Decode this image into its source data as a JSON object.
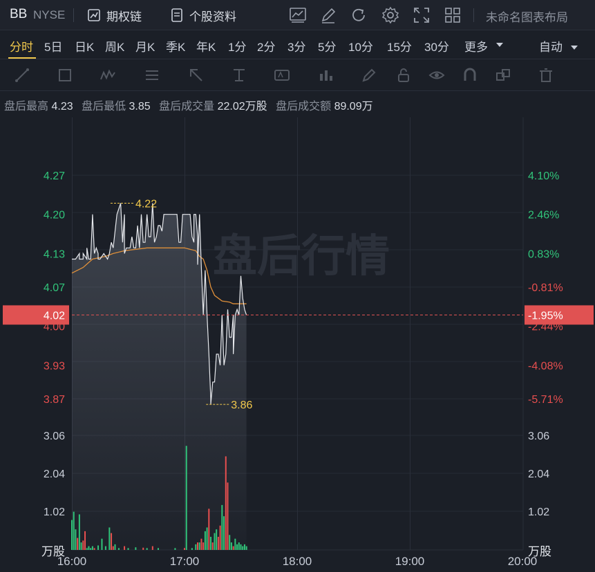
{
  "toolbar": {
    "symbol": "BB",
    "exchange": "NYSE",
    "options_chain": "期权链",
    "stock_info": "个股资料",
    "layout_name": "未命名图表布局",
    "icons": [
      "chart-type-icon",
      "draw-icon",
      "refresh-icon",
      "settings-icon",
      "fullscreen-icon",
      "layout-grid-icon"
    ]
  },
  "periods": {
    "items": [
      "分时",
      "5日",
      "日K",
      "周K",
      "月K",
      "季K",
      "年K",
      "1分",
      "2分",
      "3分",
      "5分",
      "10分",
      "15分",
      "30分",
      "更多"
    ],
    "active": "分时",
    "auto_label": "自动"
  },
  "info": {
    "high_label": "盘后最高",
    "high": "4.23",
    "low_label": "盘后最低",
    "low": "3.85",
    "volume_label": "盘后成交量",
    "volume": "22.02万股",
    "amount_label": "盘后成交额",
    "amount": "89.09万"
  },
  "chart_data": {
    "type": "line",
    "watermark": "盘后行情",
    "x_ticks": [
      "16:00",
      "17:00",
      "18:00",
      "19:00",
      "20:00"
    ],
    "price_ticks": [
      "4.27",
      "4.20",
      "4.13",
      "4.07",
      "4.00",
      "3.93",
      "3.87"
    ],
    "pct_ticks": [
      "4.10%",
      "2.46%",
      "0.83%",
      "-0.81%",
      "-2.44%",
      "-4.08%",
      "-5.71%"
    ],
    "volume_ticks": [
      "3.06",
      "2.04",
      "1.02"
    ],
    "volume_unit": "万股",
    "current_price": "4.02",
    "current_pct": "-1.95%",
    "high_marker": "4.22",
    "low_marker": "3.86",
    "colors": {
      "up": "#e84f4f",
      "down": "#31c47a",
      "avg": "#e0903a",
      "price": "#e8eaee",
      "marker": "#f2c94c",
      "current_bg": "#e05252"
    },
    "price_series": [
      [
        0,
        4.12
      ],
      [
        2,
        4.12
      ],
      [
        4,
        4.13
      ],
      [
        4,
        4.12
      ],
      [
        6,
        4.12
      ],
      [
        6,
        4.13
      ],
      [
        8,
        4.12
      ],
      [
        8,
        4.14
      ],
      [
        9,
        4.12
      ],
      [
        10,
        4.12
      ],
      [
        11,
        4.2
      ],
      [
        12,
        4.13
      ],
      [
        13,
        4.14
      ],
      [
        14,
        4.13
      ],
      [
        14,
        4.12
      ],
      [
        15,
        4.12
      ],
      [
        17,
        4.13
      ],
      [
        19,
        4.12
      ],
      [
        20,
        4.13
      ],
      [
        21,
        4.15
      ],
      [
        22,
        4.14
      ],
      [
        24,
        4.2
      ],
      [
        26,
        4.22
      ],
      [
        27,
        4.15
      ],
      [
        28,
        4.2
      ],
      [
        28,
        4.13
      ],
      [
        29,
        4.14
      ],
      [
        31,
        4.14
      ],
      [
        32,
        4.16
      ],
      [
        33,
        4.14
      ],
      [
        34,
        4.14
      ],
      [
        35,
        4.18
      ],
      [
        36,
        4.14
      ],
      [
        37,
        4.2
      ],
      [
        38,
        4.15
      ],
      [
        39,
        4.15
      ],
      [
        40,
        4.2
      ],
      [
        41,
        4.16
      ],
      [
        42,
        4.16
      ],
      [
        43,
        4.22
      ],
      [
        44,
        4.15
      ],
      [
        45,
        4.16
      ],
      [
        46,
        4.18
      ],
      [
        47,
        4.18
      ],
      [
        48,
        4.17
      ],
      [
        49,
        4.2
      ],
      [
        52,
        4.2
      ],
      [
        54,
        4.2
      ],
      [
        55,
        4.2
      ],
      [
        56,
        4.2
      ],
      [
        57,
        4.15
      ],
      [
        58,
        4.15
      ],
      [
        59,
        4.2
      ],
      [
        61,
        4.2
      ],
      [
        63,
        4.2
      ],
      [
        64,
        4.16
      ],
      [
        65,
        4.15
      ],
      [
        65,
        4.2
      ],
      [
        66,
        4.2
      ],
      [
        67,
        4.16
      ],
      [
        67,
        4.11
      ],
      [
        68,
        4.2
      ],
      [
        69,
        4.1
      ],
      [
        70,
        4.02
      ],
      [
        71,
        4.1
      ],
      [
        72,
        4.02
      ],
      [
        73,
        3.95
      ],
      [
        74,
        3.87
      ],
      [
        74,
        3.86
      ],
      [
        75,
        3.9
      ],
      [
        76,
        3.9
      ],
      [
        77,
        3.95
      ],
      [
        78,
        3.95
      ],
      [
        79,
        3.93
      ],
      [
        80,
        4.02
      ],
      [
        81,
        3.93
      ],
      [
        82,
        3.95
      ],
      [
        83,
        4.03
      ],
      [
        84,
        3.98
      ],
      [
        85,
        3.98
      ],
      [
        86,
        4.02
      ],
      [
        86,
        3.95
      ],
      [
        87,
        4.02
      ],
      [
        88,
        4.03
      ],
      [
        88,
        4.03
      ],
      [
        89,
        4.02
      ],
      [
        90,
        4.09
      ],
      [
        91,
        4.05
      ],
      [
        92,
        4.03
      ],
      [
        93,
        4.02
      ]
    ],
    "avg_series": [
      [
        0,
        4.095
      ],
      [
        6,
        4.105
      ],
      [
        11,
        4.12
      ],
      [
        18,
        4.125
      ],
      [
        22,
        4.13
      ],
      [
        28,
        4.135
      ],
      [
        40,
        4.14
      ],
      [
        60,
        4.14
      ],
      [
        66,
        4.135
      ],
      [
        67,
        4.13
      ],
      [
        68,
        4.125
      ],
      [
        70,
        4.12
      ],
      [
        72,
        4.1
      ],
      [
        74,
        4.07
      ],
      [
        76,
        4.055
      ],
      [
        78,
        4.05
      ],
      [
        80,
        4.045
      ],
      [
        84,
        4.043
      ],
      [
        86,
        4.04
      ],
      [
        90,
        4.04
      ],
      [
        93,
        4.04
      ]
    ],
    "volume_series": [
      {
        "m": 0,
        "v": 0.8,
        "c": "down"
      },
      {
        "m": 1,
        "v": 1.02,
        "c": "down"
      },
      {
        "m": 2,
        "v": 0.55,
        "c": "down"
      },
      {
        "m": 3,
        "v": 0.32,
        "c": "up"
      },
      {
        "m": 4,
        "v": 0.95,
        "c": "down"
      },
      {
        "m": 5,
        "v": 0.2,
        "c": "down"
      },
      {
        "m": 6,
        "v": 0.25,
        "c": "up"
      },
      {
        "m": 7,
        "v": 0.5,
        "c": "up"
      },
      {
        "m": 8,
        "v": 0.05,
        "c": "down"
      },
      {
        "m": 9,
        "v": 0.1,
        "c": "down"
      },
      {
        "m": 10,
        "v": 0.05,
        "c": "down"
      },
      {
        "m": 11,
        "v": 0.1,
        "c": "down"
      },
      {
        "m": 12,
        "v": 0.05,
        "c": "up"
      },
      {
        "m": 14,
        "v": 0.12,
        "c": "down"
      },
      {
        "m": 16,
        "v": 0.3,
        "c": "down"
      },
      {
        "m": 18,
        "v": 0.1,
        "c": "down"
      },
      {
        "m": 20,
        "v": 0.6,
        "c": "down"
      },
      {
        "m": 21,
        "v": 0.45,
        "c": "up"
      },
      {
        "m": 22,
        "v": 0.1,
        "c": "up"
      },
      {
        "m": 23,
        "v": 0.15,
        "c": "down"
      },
      {
        "m": 25,
        "v": 0.05,
        "c": "down"
      },
      {
        "m": 28,
        "v": 0.1,
        "c": "up"
      },
      {
        "m": 30,
        "v": 0.05,
        "c": "down"
      },
      {
        "m": 34,
        "v": 0.07,
        "c": "down"
      },
      {
        "m": 38,
        "v": 0.06,
        "c": "up"
      },
      {
        "m": 40,
        "v": 0.05,
        "c": "down"
      },
      {
        "m": 43,
        "v": 0.1,
        "c": "up"
      },
      {
        "m": 46,
        "v": 0.05,
        "c": "down"
      },
      {
        "m": 55,
        "v": 0.05,
        "c": "down"
      },
      {
        "m": 60,
        "v": 0.05,
        "c": "up"
      },
      {
        "m": 61,
        "v": 2.78,
        "c": "down"
      },
      {
        "m": 64,
        "v": 0.05,
        "c": "down"
      },
      {
        "m": 66,
        "v": 0.15,
        "c": "down"
      },
      {
        "m": 67,
        "v": 0.2,
        "c": "up"
      },
      {
        "m": 68,
        "v": 0.2,
        "c": "down"
      },
      {
        "m": 69,
        "v": 0.3,
        "c": "up"
      },
      {
        "m": 70,
        "v": 0.2,
        "c": "up"
      },
      {
        "m": 71,
        "v": 0.5,
        "c": "down"
      },
      {
        "m": 72,
        "v": 0.6,
        "c": "down"
      },
      {
        "m": 73,
        "v": 1.1,
        "c": "up"
      },
      {
        "m": 74,
        "v": 0.35,
        "c": "down"
      },
      {
        "m": 75,
        "v": 0.2,
        "c": "up"
      },
      {
        "m": 76,
        "v": 0.45,
        "c": "down"
      },
      {
        "m": 77,
        "v": 0.55,
        "c": "down"
      },
      {
        "m": 78,
        "v": 0.35,
        "c": "up"
      },
      {
        "m": 79,
        "v": 0.65,
        "c": "up"
      },
      {
        "m": 80,
        "v": 1.2,
        "c": "down"
      },
      {
        "m": 81,
        "v": 0.9,
        "c": "down"
      },
      {
        "m": 82,
        "v": 2.5,
        "c": "up"
      },
      {
        "m": 83,
        "v": 1.8,
        "c": "up"
      },
      {
        "m": 84,
        "v": 0.4,
        "c": "down"
      },
      {
        "m": 85,
        "v": 0.2,
        "c": "down"
      },
      {
        "m": 86,
        "v": 0.1,
        "c": "up"
      },
      {
        "m": 87,
        "v": 0.3,
        "c": "down"
      },
      {
        "m": 88,
        "v": 0.15,
        "c": "down"
      },
      {
        "m": 89,
        "v": 0.2,
        "c": "down"
      },
      {
        "m": 90,
        "v": 0.15,
        "c": "down"
      },
      {
        "m": 91,
        "v": 0.1,
        "c": "down"
      },
      {
        "m": 92,
        "v": 0.15,
        "c": "down"
      },
      {
        "m": 93,
        "v": 0.1,
        "c": "down"
      }
    ]
  }
}
